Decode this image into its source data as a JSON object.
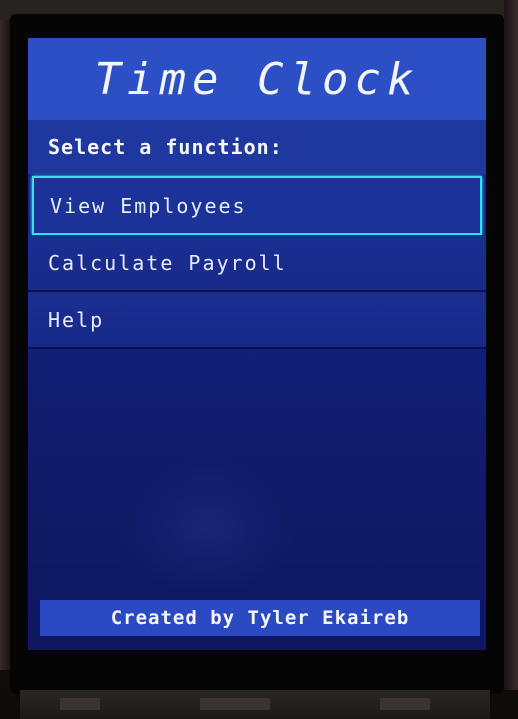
{
  "screen": {
    "title": "Time Clock",
    "prompt": "Select a function:",
    "menu": {
      "items": [
        {
          "label": "View Employees",
          "selected": true
        },
        {
          "label": "Calculate Payroll",
          "selected": false
        },
        {
          "label": "Help",
          "selected": false
        }
      ]
    },
    "footer": "Created by Tyler Ekaireb"
  },
  "colors": {
    "title_bar": "#2c4fc6",
    "prompt_bar": "#1e389f",
    "screen_background": "#13217a",
    "selection_outline": "#35e0ec",
    "footer_bar": "#2b49c3",
    "text": "#f2f4ff"
  }
}
